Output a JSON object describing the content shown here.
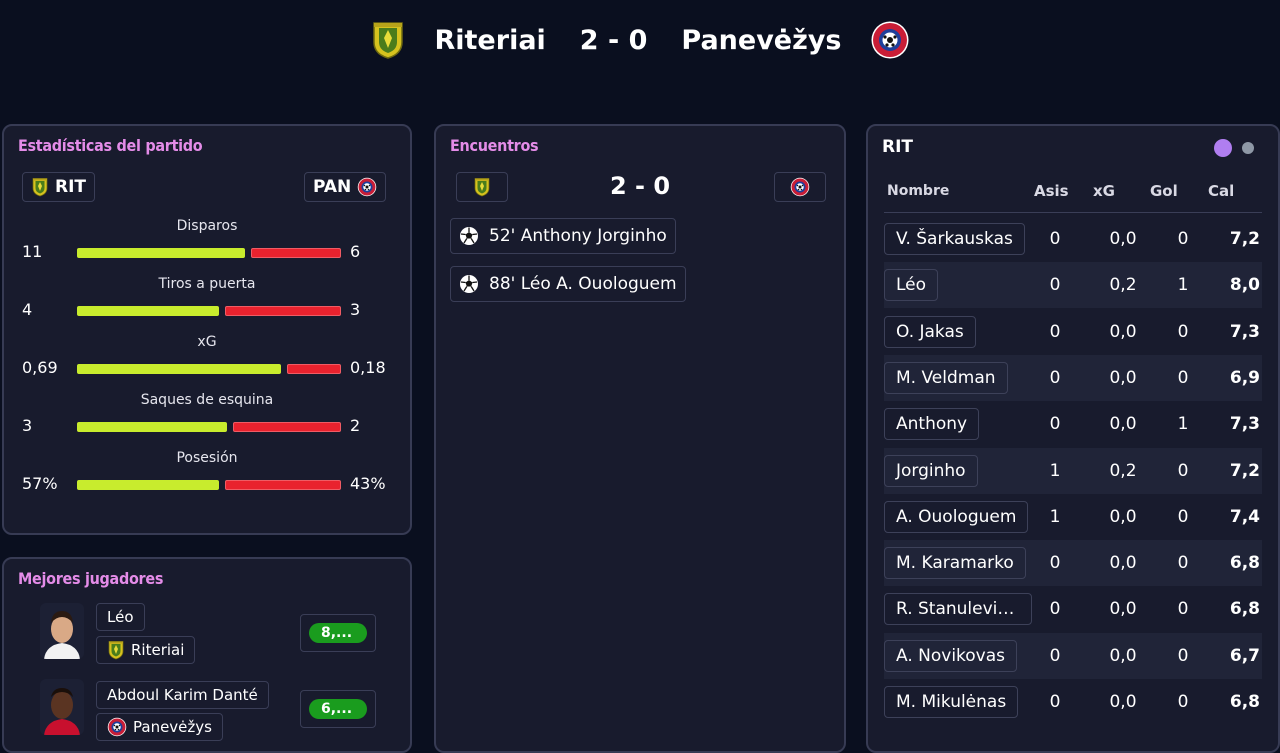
{
  "header": {
    "home_team": "Riteriai",
    "score": "2 - 0",
    "away_team": "Panevėžys"
  },
  "stats": {
    "title": "Estadísticas del partido",
    "home_abbr": "RIT",
    "away_abbr": "PAN",
    "rows": [
      {
        "label": "Disparos",
        "home": "11",
        "away": "6",
        "home_share": 0.65
      },
      {
        "label": "Tiros a puerta",
        "home": "4",
        "away": "3",
        "home_share": 0.55
      },
      {
        "label": "xG",
        "home": "0,69",
        "away": "0,18",
        "home_share": 0.79
      },
      {
        "label": "Saques de esquina",
        "home": "3",
        "away": "2",
        "home_share": 0.58
      },
      {
        "label": "Posesión",
        "home": "57%",
        "away": "43%",
        "home_share": 0.55
      }
    ]
  },
  "best_players": {
    "title": "Mejores jugadores",
    "players": [
      {
        "name": "Léo",
        "team": "Riteriai",
        "rating": "8,..."
      },
      {
        "name": "Abdoul Karim Danté",
        "team": "Panevėžys",
        "rating": "6,..."
      }
    ]
  },
  "events": {
    "title": "Encuentros",
    "score": "2 - 0",
    "items": [
      {
        "text": "52' Anthony Jorginho"
      },
      {
        "text": "88' Léo A. Ouologuem"
      }
    ]
  },
  "team_table": {
    "title": "RIT",
    "headers": {
      "name": "Nombre",
      "asis": "Asis",
      "xg": "xG",
      "gol": "Gol",
      "cal": "Cal"
    },
    "rows": [
      {
        "name": "V. Šarkauskas",
        "asis": "0",
        "xg": "0,0",
        "gol": "0",
        "cal": "7,2"
      },
      {
        "name": "Léo",
        "asis": "0",
        "xg": "0,2",
        "gol": "1",
        "cal": "8,0"
      },
      {
        "name": "O. Jakas",
        "asis": "0",
        "xg": "0,0",
        "gol": "0",
        "cal": "7,3"
      },
      {
        "name": "M. Veldman",
        "asis": "0",
        "xg": "0,0",
        "gol": "0",
        "cal": "6,9"
      },
      {
        "name": "Anthony",
        "asis": "0",
        "xg": "0,0",
        "gol": "1",
        "cal": "7,3"
      },
      {
        "name": "Jorginho",
        "asis": "1",
        "xg": "0,2",
        "gol": "0",
        "cal": "7,2"
      },
      {
        "name": "A. Ouologuem",
        "asis": "1",
        "xg": "0,0",
        "gol": "0",
        "cal": "7,4"
      },
      {
        "name": "M. Karamarko",
        "asis": "0",
        "xg": "0,0",
        "gol": "0",
        "cal": "6,8"
      },
      {
        "name": "R. Stanulevičius",
        "asis": "0",
        "xg": "0,0",
        "gol": "0",
        "cal": "6,8"
      },
      {
        "name": "A. Novikovas",
        "asis": "0",
        "xg": "0,0",
        "gol": "0",
        "cal": "6,7"
      },
      {
        "name": "M. Mikulėnas",
        "asis": "0",
        "xg": "0,0",
        "gol": "0",
        "cal": "6,8"
      }
    ]
  },
  "colors": {
    "home_bar": "#c8ec2d",
    "away_bar": "#e9222e",
    "title_accent": "#e48ce8",
    "dot_active": "#b07ef0",
    "dot_inactive": "#8e98a6"
  },
  "icons": {
    "home_crest": "riteriai-crest-icon",
    "away_crest": "panevezys-crest-icon",
    "goal": "soccer-ball-icon"
  }
}
